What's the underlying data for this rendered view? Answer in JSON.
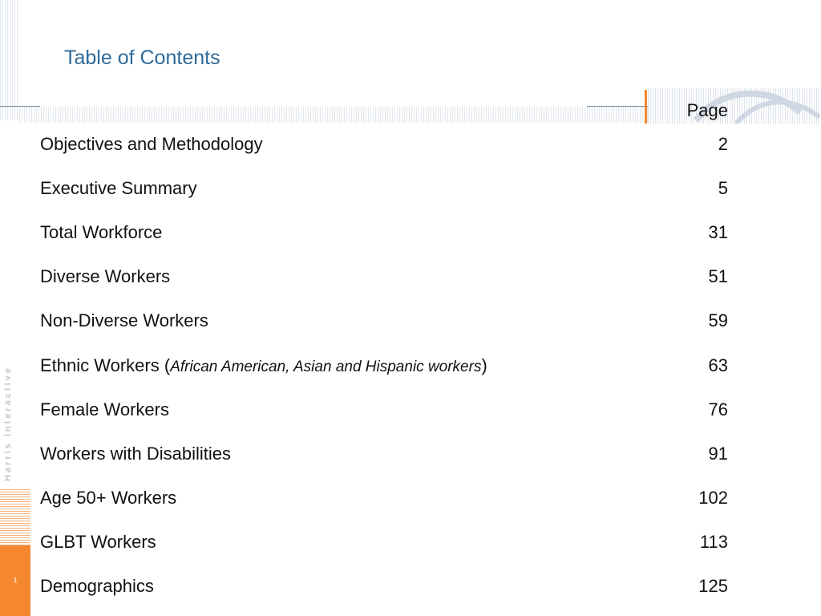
{
  "title": "Table of Contents",
  "page_column_header": "Page",
  "entries": [
    {
      "label": "Objectives and Methodology",
      "note": "",
      "page": "2"
    },
    {
      "label": "Executive Summary",
      "note": "",
      "page": "5"
    },
    {
      "label": "Total Workforce",
      "note": "",
      "page": "31"
    },
    {
      "label": "Diverse Workers",
      "note": "",
      "page": "51"
    },
    {
      "label": "Non-Diverse Workers",
      "note": "",
      "page": "59"
    },
    {
      "label": "Ethnic Workers",
      "note": "African American, Asian and Hispanic workers",
      "page": "63"
    },
    {
      "label": "Female Workers",
      "note": "",
      "page": "76"
    },
    {
      "label": "Workers with Disabilities",
      "note": "",
      "page": "91"
    },
    {
      "label": "Age 50+ Workers",
      "note": "",
      "page": "102"
    },
    {
      "label": "GLBT Workers",
      "note": "",
      "page": "113"
    },
    {
      "label": "Demographics",
      "note": "",
      "page": "125"
    }
  ],
  "brand": "Harris Interactive",
  "slide_number": "1",
  "colors": {
    "title": "#2f6a99",
    "accent": "#f5872f"
  }
}
